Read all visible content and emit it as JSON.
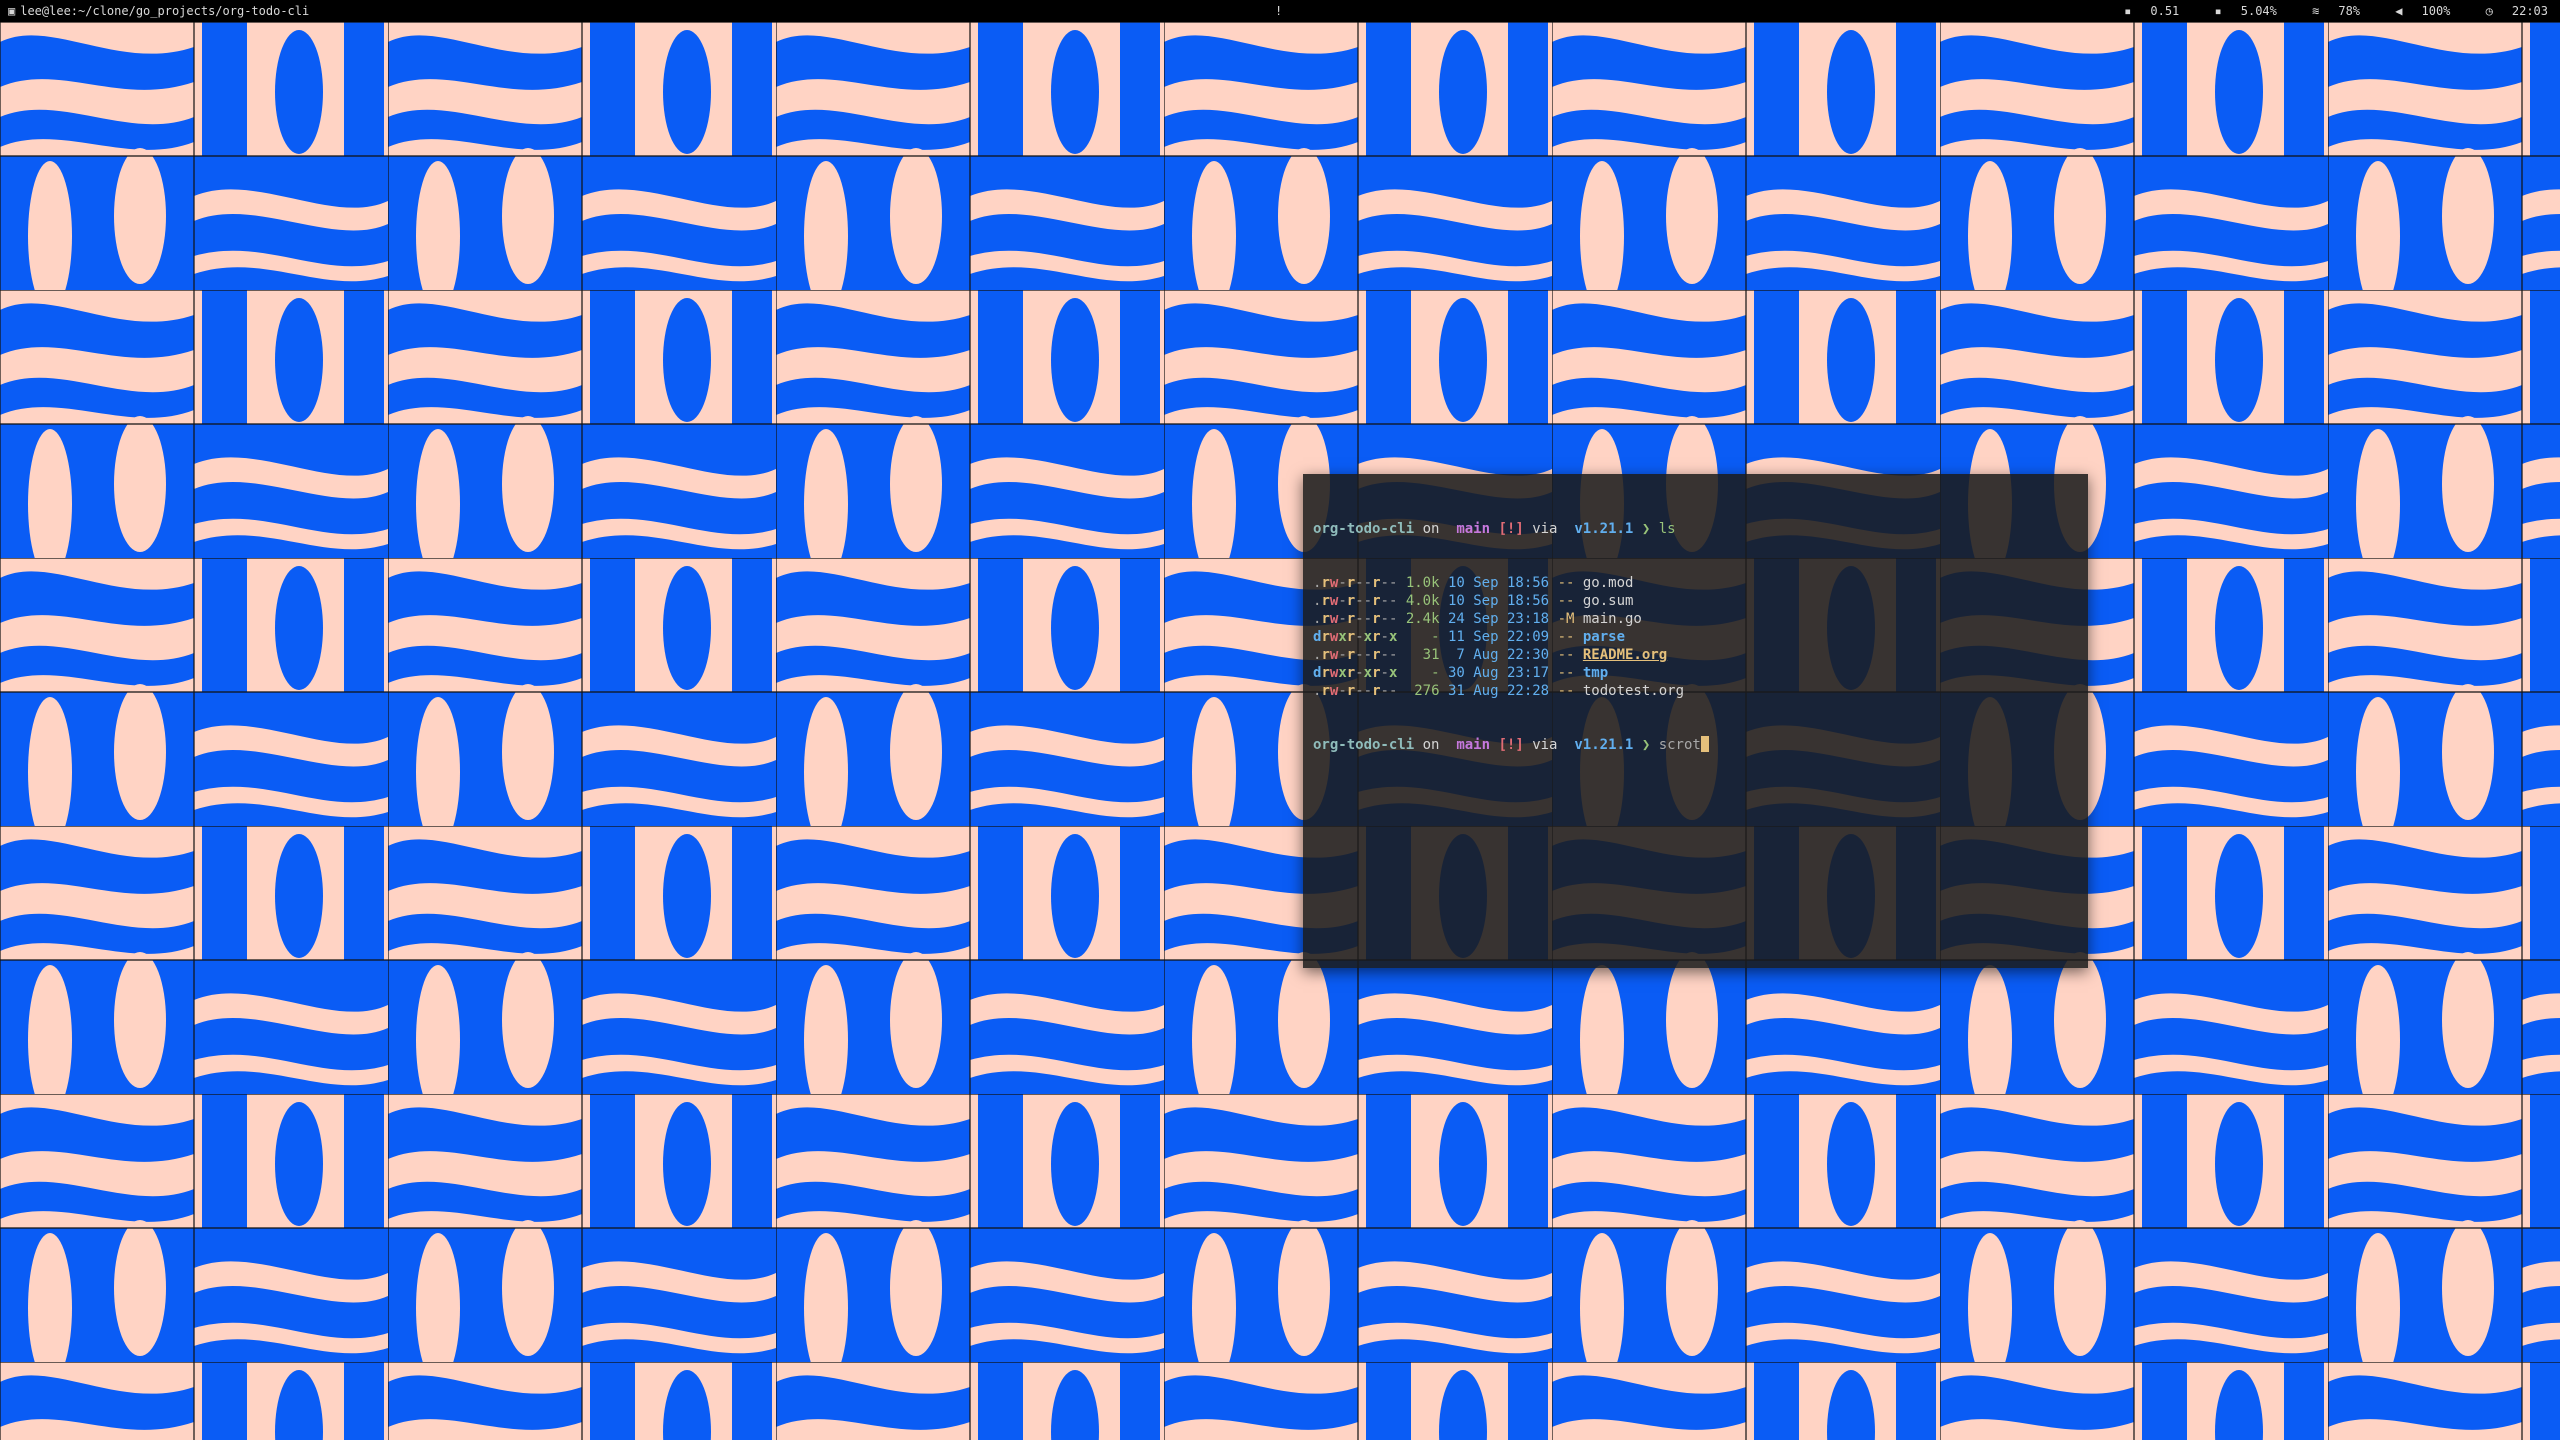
{
  "topbar": {
    "window_title": "lee@lee:~/clone/go_projects/org-todo-cli",
    "center_mark": "!",
    "status": {
      "cpu_icon": "cpu-icon",
      "cpu": "0.51",
      "mem_icon": "memory-icon",
      "mem": "5.04%",
      "wifi_icon": "wifi-icon",
      "wifi": "78%",
      "volume_icon": "volume-icon",
      "volume": "100%",
      "clock_icon": "clock-icon",
      "time": "22:03"
    }
  },
  "colors": {
    "wallpaper_blue": "#0a5cf5",
    "wallpaper_peach": "#ffd3c4",
    "terminal_bg": "#1a1a1a"
  },
  "terminal": {
    "prompt": {
      "dir": "org-todo-cli",
      "on": " on ",
      "branch_icon": "",
      "branch": "main",
      "status": "[!]",
      "via": " via ",
      "go_icon": "",
      "go_version": "v1.21.1",
      "arrow": "❯"
    },
    "command1": "ls",
    "listing": [
      {
        "perm": ".rw-r--r--",
        "size": "1.0k",
        "date": "10 Sep 18:56",
        "git": "--",
        "name": "go.mod",
        "kind": "file"
      },
      {
        "perm": ".rw-r--r--",
        "size": "4.0k",
        "date": "10 Sep 18:56",
        "git": "--",
        "name": "go.sum",
        "kind": "file"
      },
      {
        "perm": ".rw-r--r--",
        "size": "2.4k",
        "date": "24 Sep 23:18",
        "git": "-M",
        "name": "main.go",
        "kind": "file"
      },
      {
        "perm": "drwxr-xr-x",
        "size": "-",
        "date": "11 Sep 22:09",
        "git": "--",
        "name": "parse",
        "kind": "dir"
      },
      {
        "perm": ".rw-r--r--",
        "size": "31",
        "date": "7 Aug 22:30",
        "git": "--",
        "name": "README.org",
        "kind": "readme"
      },
      {
        "perm": "drwxr-xr-x",
        "size": "-",
        "date": "30 Aug 23:17",
        "git": "--",
        "name": "tmp",
        "kind": "dir"
      },
      {
        "perm": ".rw-r--r--",
        "size": "276",
        "date": "31 Aug 22:28",
        "git": "--",
        "name": "todotest.org",
        "kind": "file"
      }
    ],
    "command2": "scrot"
  }
}
